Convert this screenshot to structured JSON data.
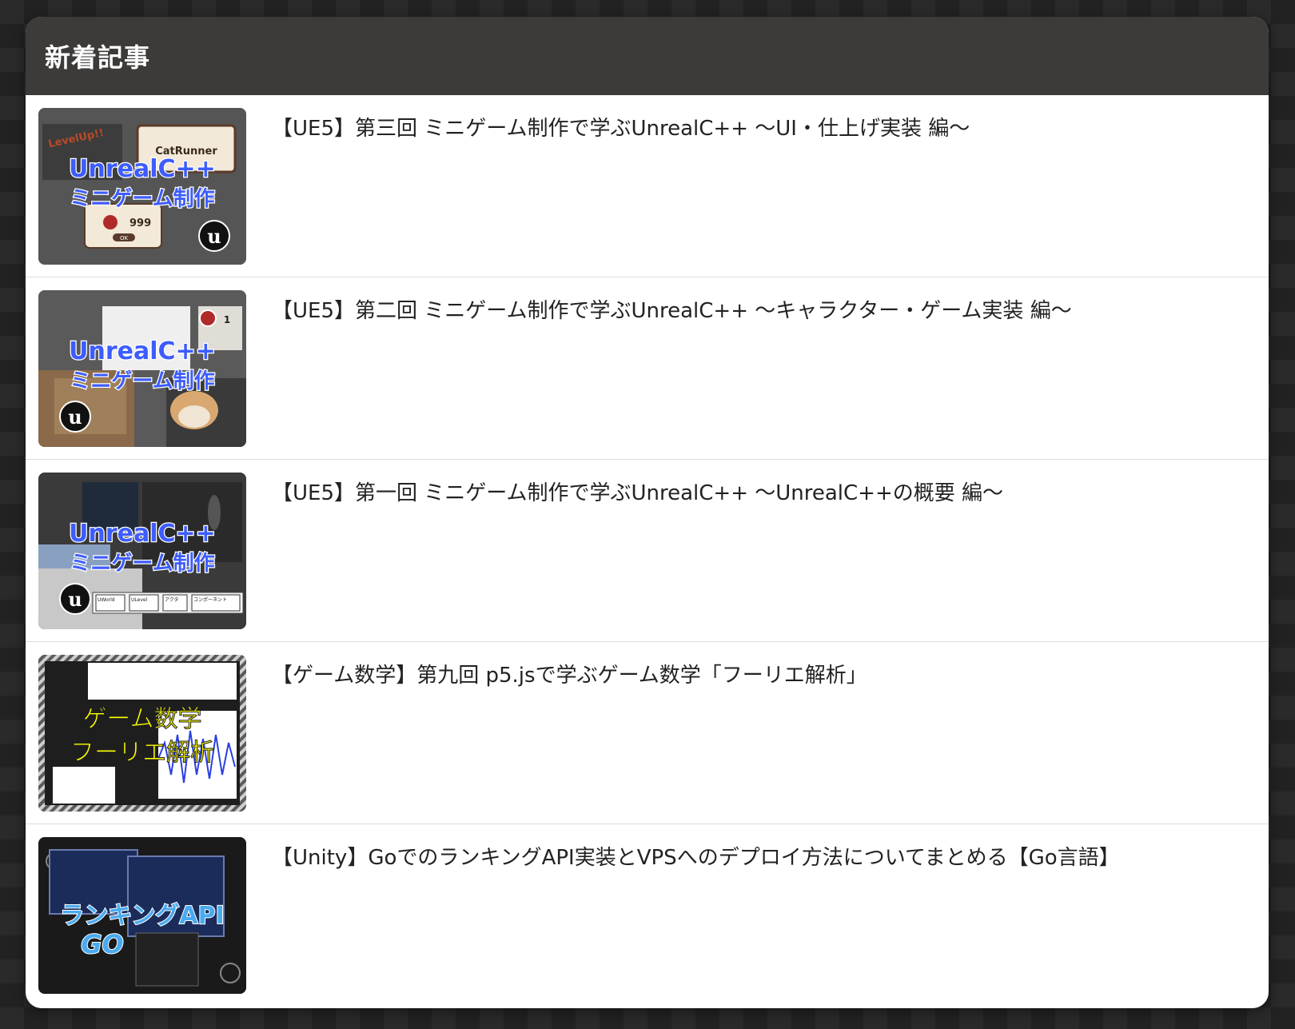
{
  "header": {
    "title": "新着記事"
  },
  "articles": [
    {
      "title": "【UE5】第三回 ミニゲーム制作で学ぶUnrealC++ 〜UI・仕上げ実装 編〜",
      "thumb": {
        "line1": "UnrealC++",
        "line2": "ミニゲーム制作",
        "badge": "CatRunner",
        "tag": "LevelUp!!",
        "count": "999",
        "ok": "OK",
        "logo": "u"
      }
    },
    {
      "title": "【UE5】第二回 ミニゲーム制作で学ぶUnrealC++ 〜キャラクター・ゲーム実装 編〜",
      "thumb": {
        "line1": "UnrealC++",
        "line2": "ミニゲーム制作",
        "count": "1",
        "logo": "u"
      }
    },
    {
      "title": "【UE5】第一回 ミニゲーム制作で学ぶUnrealC++ 〜UnrealC++の概要 編〜",
      "thumb": {
        "line1": "UnrealC++",
        "line2": "ミニゲーム制作",
        "logo": "u",
        "flow": [
          "UWorld",
          "ULevel",
          "アクタ",
          "コンポーネント"
        ]
      }
    },
    {
      "title": "【ゲーム数学】第九回 p5.jsで学ぶゲーム数学「フーリエ解析」",
      "thumb": {
        "line1": "ゲーム数学",
        "line2": "フーリエ解析"
      }
    },
    {
      "title": "【Unity】GoでのランキングAPI実装とVPSへのデプロイ方法についてまとめる【Go言語】",
      "thumb": {
        "line1": "ランキングAPI",
        "line2": "GO"
      }
    }
  ]
}
